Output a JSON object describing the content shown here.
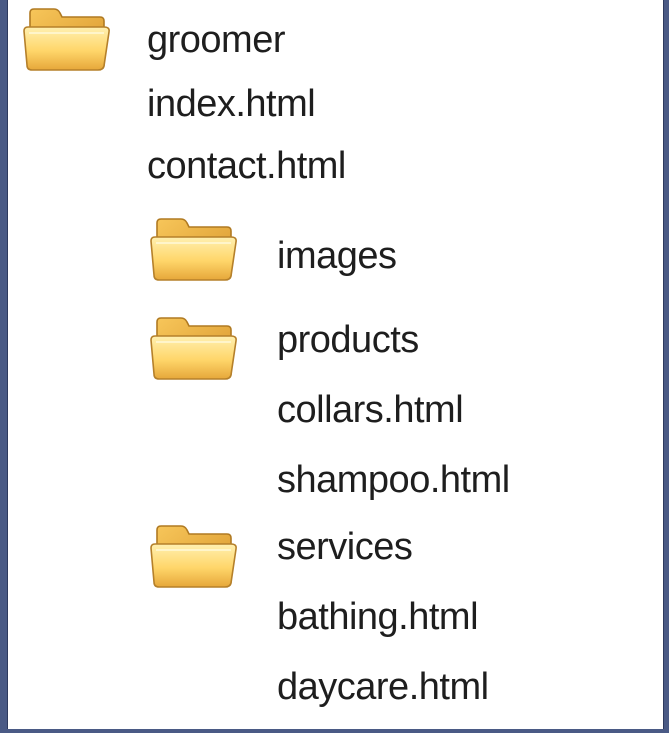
{
  "tree": {
    "root": {
      "label": "groomer",
      "icon": "folder-icon"
    },
    "root_files": [
      {
        "label": "index.html"
      },
      {
        "label": "contact.html"
      }
    ],
    "images": {
      "label": "images",
      "icon": "folder-icon"
    },
    "products": {
      "label": "products",
      "icon": "folder-icon",
      "files": [
        {
          "label": "collars.html"
        },
        {
          "label": "shampoo.html"
        }
      ]
    },
    "services": {
      "label": "services",
      "icon": "folder-icon",
      "files": [
        {
          "label": "bathing.html"
        },
        {
          "label": "daycare.html"
        }
      ]
    }
  },
  "colors": {
    "background": "#4a5a85",
    "panel": "#ffffff",
    "folder_light": "#ffe89a",
    "folder_dark": "#e0a93a",
    "text": "#1e1e1e"
  }
}
